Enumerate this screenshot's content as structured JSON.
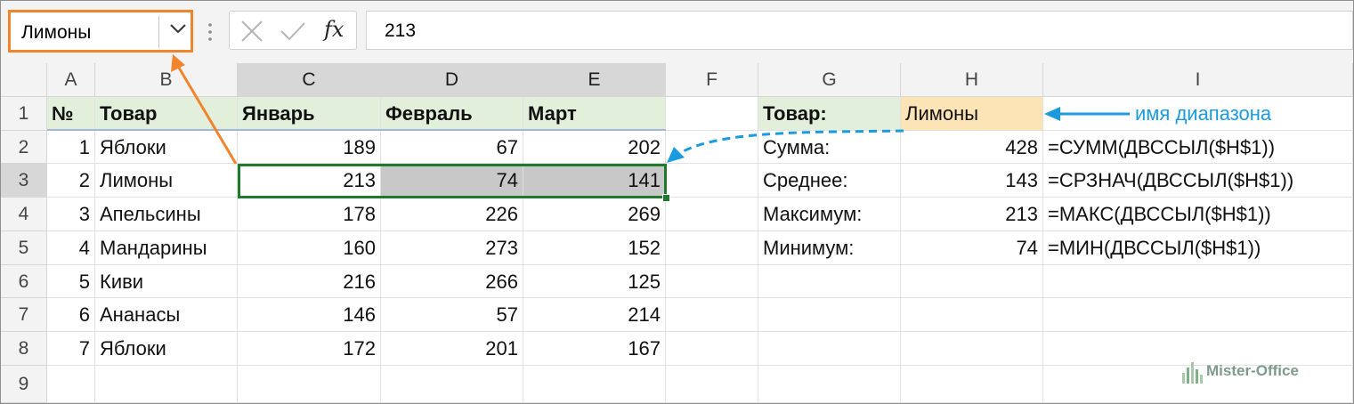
{
  "formula_bar": {
    "name_box": "Лимоны",
    "formula_value": "213",
    "fx_label": "fx"
  },
  "columns": [
    "A",
    "B",
    "C",
    "D",
    "E",
    "F",
    "G",
    "H",
    "I"
  ],
  "rows": [
    "1",
    "2",
    "3",
    "4",
    "5",
    "6",
    "7",
    "8",
    "9"
  ],
  "table": {
    "headers": {
      "num": "№",
      "product": "Товар",
      "jan": "Январь",
      "feb": "Февраль",
      "mar": "Март"
    },
    "rows": [
      {
        "num": "1",
        "product": "Яблоки",
        "jan": "189",
        "feb": "67",
        "mar": "202"
      },
      {
        "num": "2",
        "product": "Лимоны",
        "jan": "213",
        "feb": "74",
        "mar": "141"
      },
      {
        "num": "3",
        "product": "Апельсины",
        "jan": "178",
        "feb": "226",
        "mar": "269"
      },
      {
        "num": "4",
        "product": "Мандарины",
        "jan": "160",
        "feb": "273",
        "mar": "152"
      },
      {
        "num": "5",
        "product": "Киви",
        "jan": "216",
        "feb": "266",
        "mar": "125"
      },
      {
        "num": "6",
        "product": "Ананасы",
        "jan": "146",
        "feb": "57",
        "mar": "214"
      },
      {
        "num": "7",
        "product": "Яблоки",
        "jan": "172",
        "feb": "201",
        "mar": "167"
      }
    ]
  },
  "summary": {
    "label": "Товар:",
    "value": "Лимоны",
    "rows": [
      {
        "label": "Сумма:",
        "value": "428",
        "formula": "=СУММ(ДВССЫЛ($H$1))"
      },
      {
        "label": "Среднее:",
        "value": "143",
        "formula": "=СРЗНАЧ(ДВССЫЛ($H$1))"
      },
      {
        "label": "Максимум:",
        "value": "213",
        "formula": "=МАКС(ДВССЫЛ($H$1))"
      },
      {
        "label": "Минимум:",
        "value": "74",
        "formula": "=МИН(ДВССЫЛ($H$1))"
      }
    ]
  },
  "annotation": {
    "range_name_label": "имя диапазона"
  },
  "logo_text": "Mister-Office",
  "colors": {
    "accent_orange": "#f0852d",
    "header_green": "#e2efda",
    "name_yellow": "#fce4b6",
    "selection_green": "#1e7a2c",
    "annotation_blue": "#1a9be0",
    "selected_gray": "#c8c8c8"
  }
}
